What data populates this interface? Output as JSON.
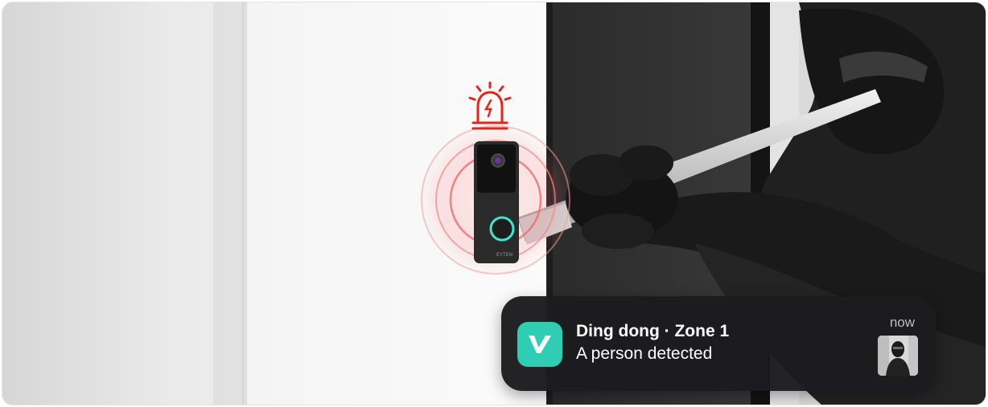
{
  "notification": {
    "title": "Ding dong · Zone 1",
    "body": "A person detected",
    "time": "now",
    "app_icon": "v-logo-icon",
    "thumbnail": "intruder-thumbnail"
  },
  "scene": {
    "alarm_icon": "siren-alarm-icon",
    "device": "video-doorbell",
    "device_brand_text": "EYTEN",
    "colors": {
      "alarm_red": "#e8231a",
      "ring_teal": "#3ee6d2",
      "app_teal": "#2ecdb4",
      "notification_bg": "#1c1c1e"
    }
  }
}
